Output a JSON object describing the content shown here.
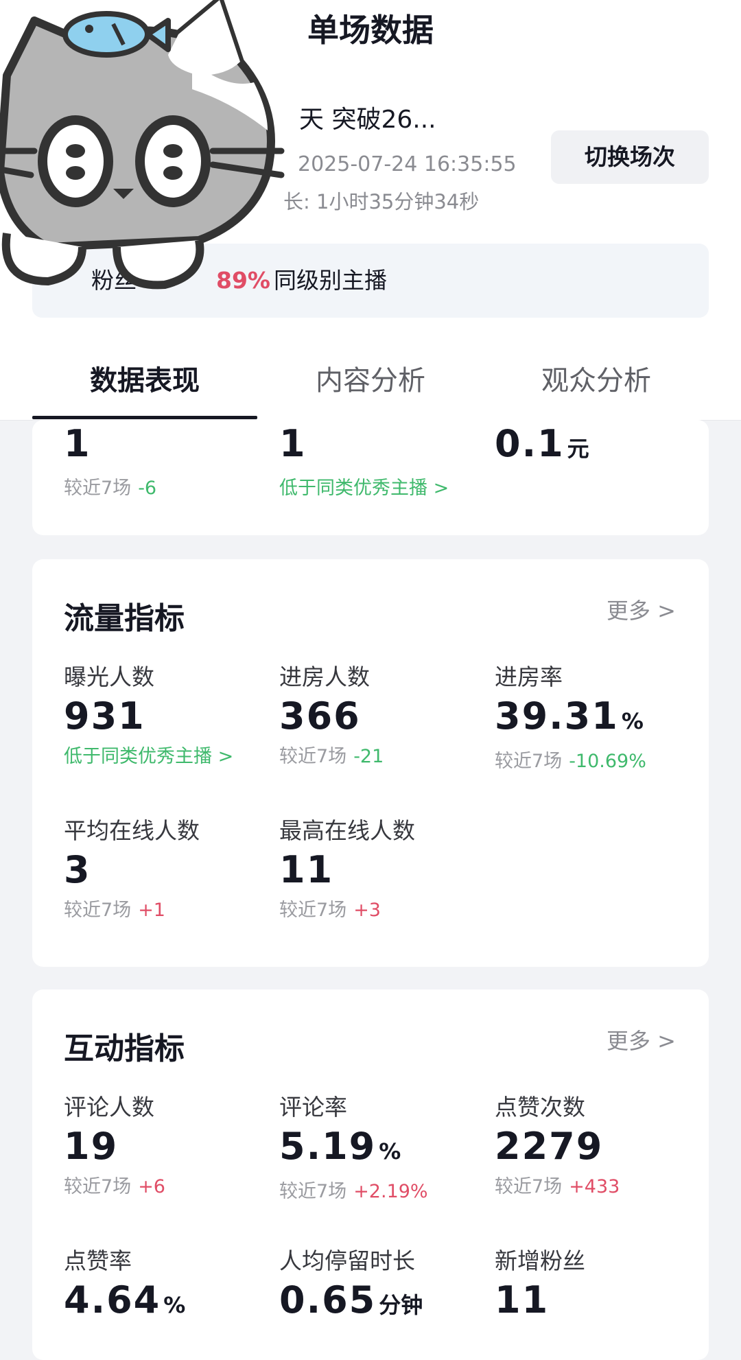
{
  "header": {
    "title": "单场数据",
    "live_title": "天 突破26...",
    "live_time": "2025-07-24 16:35:55",
    "duration_prefix": "长:",
    "duration_value": "1小时35分钟34秒",
    "switch_button": "切换场次",
    "rank": {
      "prefix": "粉丝",
      "percent": "89%",
      "suffix": "同级别主播"
    }
  },
  "tabs": [
    {
      "label": "数据表现",
      "active": true
    },
    {
      "label": "内容分析",
      "active": false
    },
    {
      "label": "观众分析",
      "active": false
    }
  ],
  "top_card": {
    "m1": {
      "value": "1",
      "cmp_label": "较近7场",
      "cmp_delta": "-6"
    },
    "m2": {
      "value": "1",
      "link": "低于同类优秀主播 >"
    },
    "m3": {
      "value": "0.1",
      "unit": "元"
    }
  },
  "traffic": {
    "title": "流量指标",
    "more": "更多 >",
    "metrics": [
      {
        "label": "曝光人数",
        "value": "931",
        "link": "低于同类优秀主播 >"
      },
      {
        "label": "进房人数",
        "value": "366",
        "cmp_label": "较近7场",
        "cmp_delta": "-21"
      },
      {
        "label": "进房率",
        "value": "39.31",
        "unit": "%",
        "cmp_label": "较近7场",
        "cmp_delta": "-10.69%"
      },
      {
        "label": "平均在线人数",
        "value": "3",
        "cmp_label": "较近7场",
        "cmp_delta": "+1"
      },
      {
        "label": "最高在线人数",
        "value": "11",
        "cmp_label": "较近7场",
        "cmp_delta": "+3"
      }
    ]
  },
  "interaction": {
    "title": "互动指标",
    "more": "更多 >",
    "metrics": [
      {
        "label": "评论人数",
        "value": "19",
        "cmp_label": "较近7场",
        "cmp_delta": "+6"
      },
      {
        "label": "评论率",
        "value": "5.19",
        "unit": "%",
        "cmp_label": "较近7场",
        "cmp_delta": "+2.19%"
      },
      {
        "label": "点赞次数",
        "value": "2279",
        "cmp_label": "较近7场",
        "cmp_delta": "+433"
      },
      {
        "label": "点赞率",
        "value": "4.64",
        "unit": "%"
      },
      {
        "label": "人均停留时长",
        "value": "0.65",
        "unit": "分钟"
      },
      {
        "label": "新增粉丝",
        "value": "11"
      }
    ]
  },
  "colors": {
    "negative": "#3fb96c",
    "positive": "#e04d66",
    "text": "#161823",
    "muted": "#9a9ba0"
  },
  "icons": {
    "avatar": "cartoon-cat-sticker",
    "chevron": "chevron-right-icon"
  }
}
